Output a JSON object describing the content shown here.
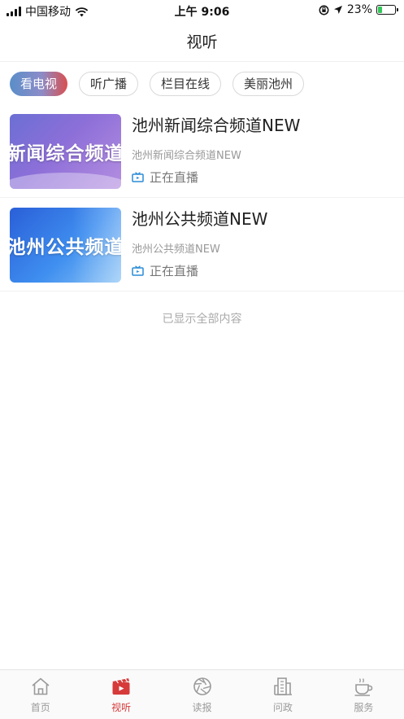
{
  "status_bar": {
    "carrier": "中国移动",
    "time": "上午 9:06",
    "battery_percent": "23%",
    "battery_level": 0.23,
    "icons": [
      "signal-icon",
      "wifi-icon",
      "lock-rotation-icon",
      "location-icon",
      "battery-icon"
    ]
  },
  "nav": {
    "title": "视听"
  },
  "tabs": [
    {
      "label": "看电视",
      "active": true
    },
    {
      "label": "听广播",
      "active": false
    },
    {
      "label": "栏目在线",
      "active": false
    },
    {
      "label": "美丽池州",
      "active": false
    }
  ],
  "channels": [
    {
      "thumb_text": "新闻综合频道",
      "name": "池州新闻综合频道NEW",
      "subtitle": "池州新闻综合频道NEW",
      "status": "正在直播"
    },
    {
      "thumb_text": "池州公共频道",
      "name": "池州公共频道NEW",
      "subtitle": "池州公共频道NEW",
      "status": "正在直播"
    }
  ],
  "end_note": "已显示全部内容",
  "tabbar": [
    {
      "label": "首页",
      "icon": "home-icon",
      "active": false
    },
    {
      "label": "视听",
      "icon": "video-clapper-icon",
      "active": true
    },
    {
      "label": "读报",
      "icon": "aperture-icon",
      "active": false
    },
    {
      "label": "问政",
      "icon": "building-icon",
      "active": false
    },
    {
      "label": "服务",
      "icon": "coffee-cup-icon",
      "active": false
    }
  ],
  "colors": {
    "accent": "#d63a3a",
    "live_icon": "#2a8bd6",
    "inactive": "#9a9a9a"
  }
}
